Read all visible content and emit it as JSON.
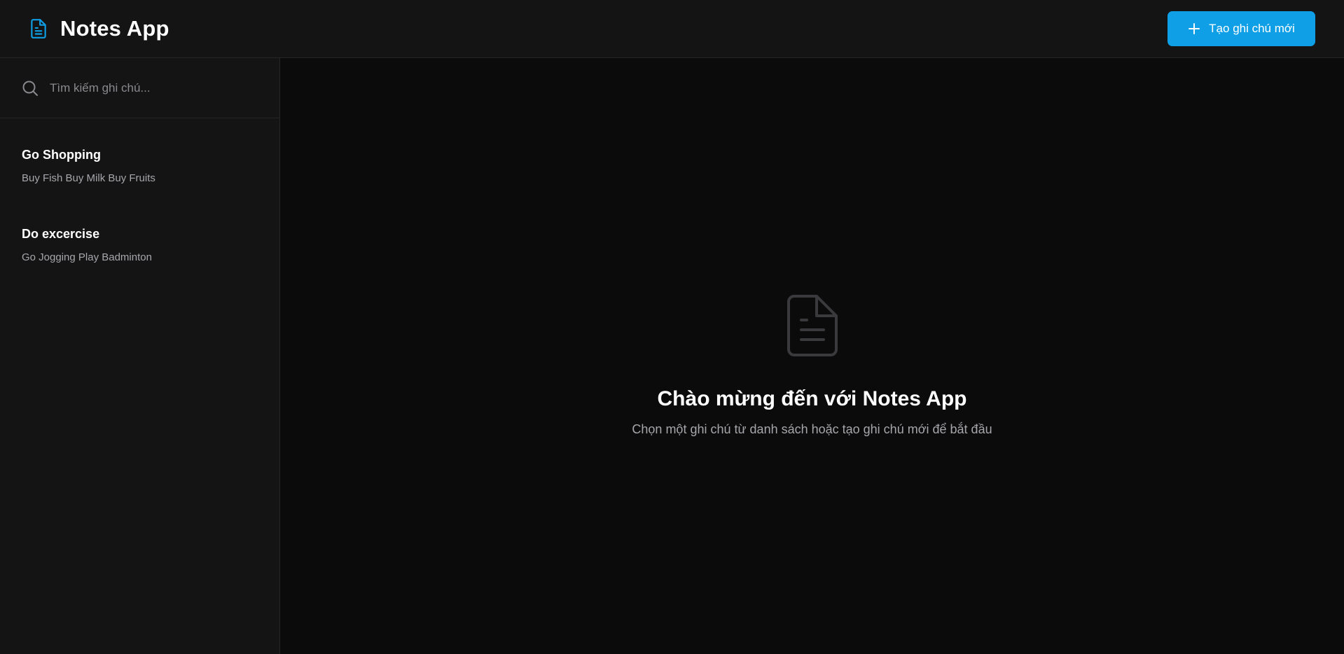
{
  "header": {
    "app_title": "Notes App",
    "new_note_label": "Tạo ghi chú mới"
  },
  "sidebar": {
    "search_placeholder": "Tìm kiếm ghi chú...",
    "notes": [
      {
        "title": "Go Shopping",
        "preview": "Buy Fish Buy Milk Buy Fruits"
      },
      {
        "title": "Do excercise",
        "preview": "Go Jogging Play Badminton"
      }
    ]
  },
  "main": {
    "welcome_title": "Chào mừng đến với Notes App",
    "welcome_subtitle": "Chọn một ghi chú từ danh sách hoặc tạo ghi chú mới để bắt đầu"
  },
  "colors": {
    "accent": "#0e9fe6",
    "background": "#0b0b0c",
    "panel": "#141415",
    "border": "#262628",
    "muted_text": "#a7a7ab"
  },
  "icons": {
    "brand": "document-icon",
    "new_note": "plus-icon",
    "search": "search-icon",
    "empty_state": "document-icon"
  }
}
